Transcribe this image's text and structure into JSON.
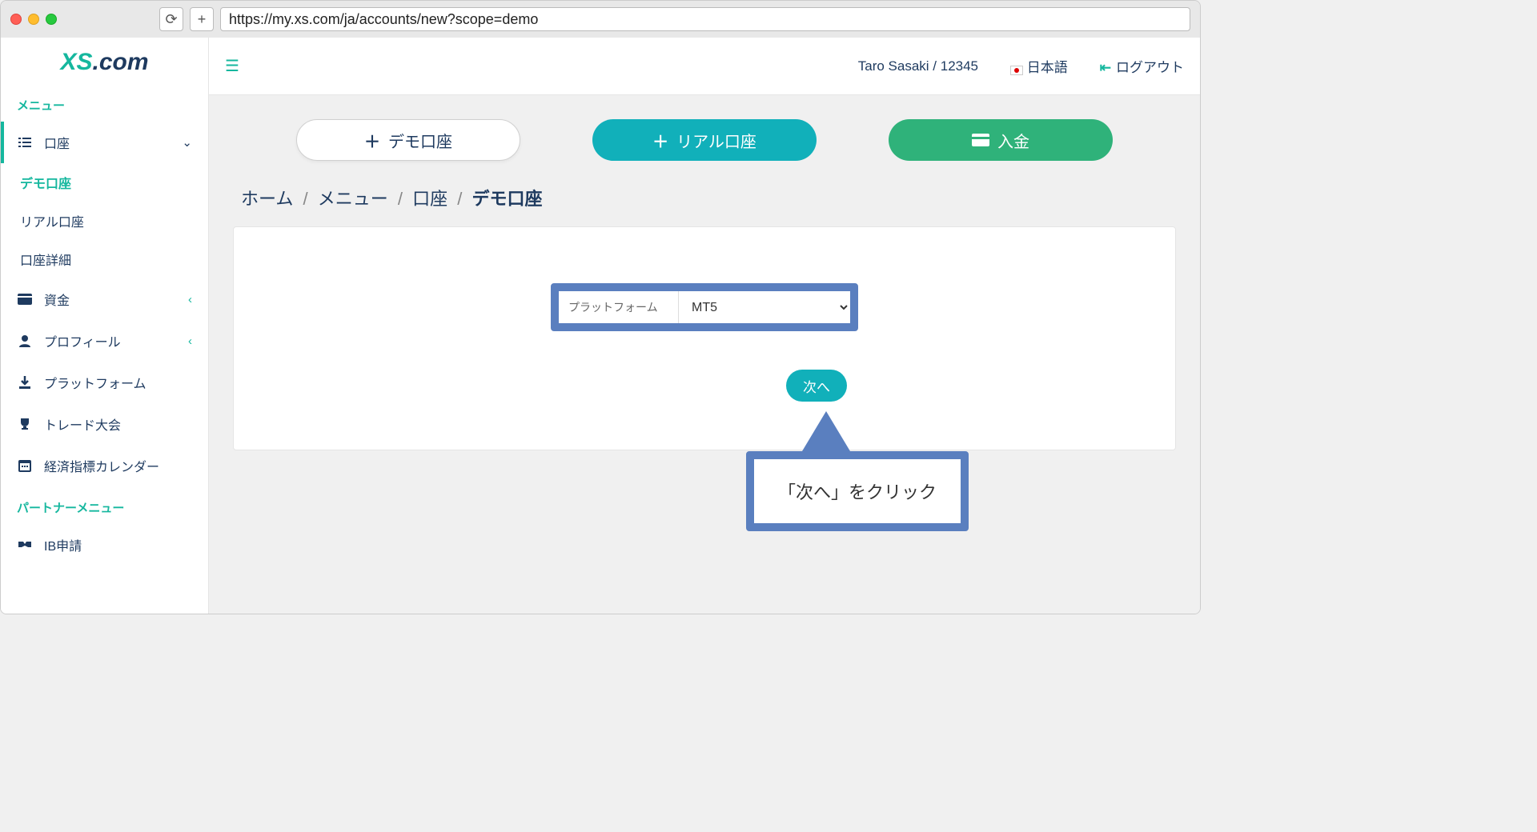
{
  "browser": {
    "url": "https://my.xs.com/ja/accounts/new?scope=demo"
  },
  "logo": {
    "xs": "XS",
    "com": ".com"
  },
  "sidebar": {
    "menu_header": "メニュー",
    "accounts": "口座",
    "sub_demo": "デモ口座",
    "sub_real": "リアル口座",
    "sub_details": "口座詳細",
    "funds": "資金",
    "profile": "プロフィール",
    "platform": "プラットフォーム",
    "contest": "トレード大会",
    "calendar": "経済指標カレンダー",
    "partner_header": "パートナーメニュー",
    "ib_apply": "IB申請"
  },
  "topbar": {
    "user": "Taro Sasaki / 12345",
    "lang": "日本語",
    "logout": "ログアウト"
  },
  "actions": {
    "demo": "デモ口座",
    "real": "リアル口座",
    "deposit": "入金"
  },
  "breadcrumb": {
    "home": "ホーム",
    "menu": "メニュー",
    "accounts": "口座",
    "current": "デモ口座"
  },
  "form": {
    "label": "プラットフォーム",
    "value": "MT5",
    "next": "次へ"
  },
  "callout": "「次へ」をクリック"
}
